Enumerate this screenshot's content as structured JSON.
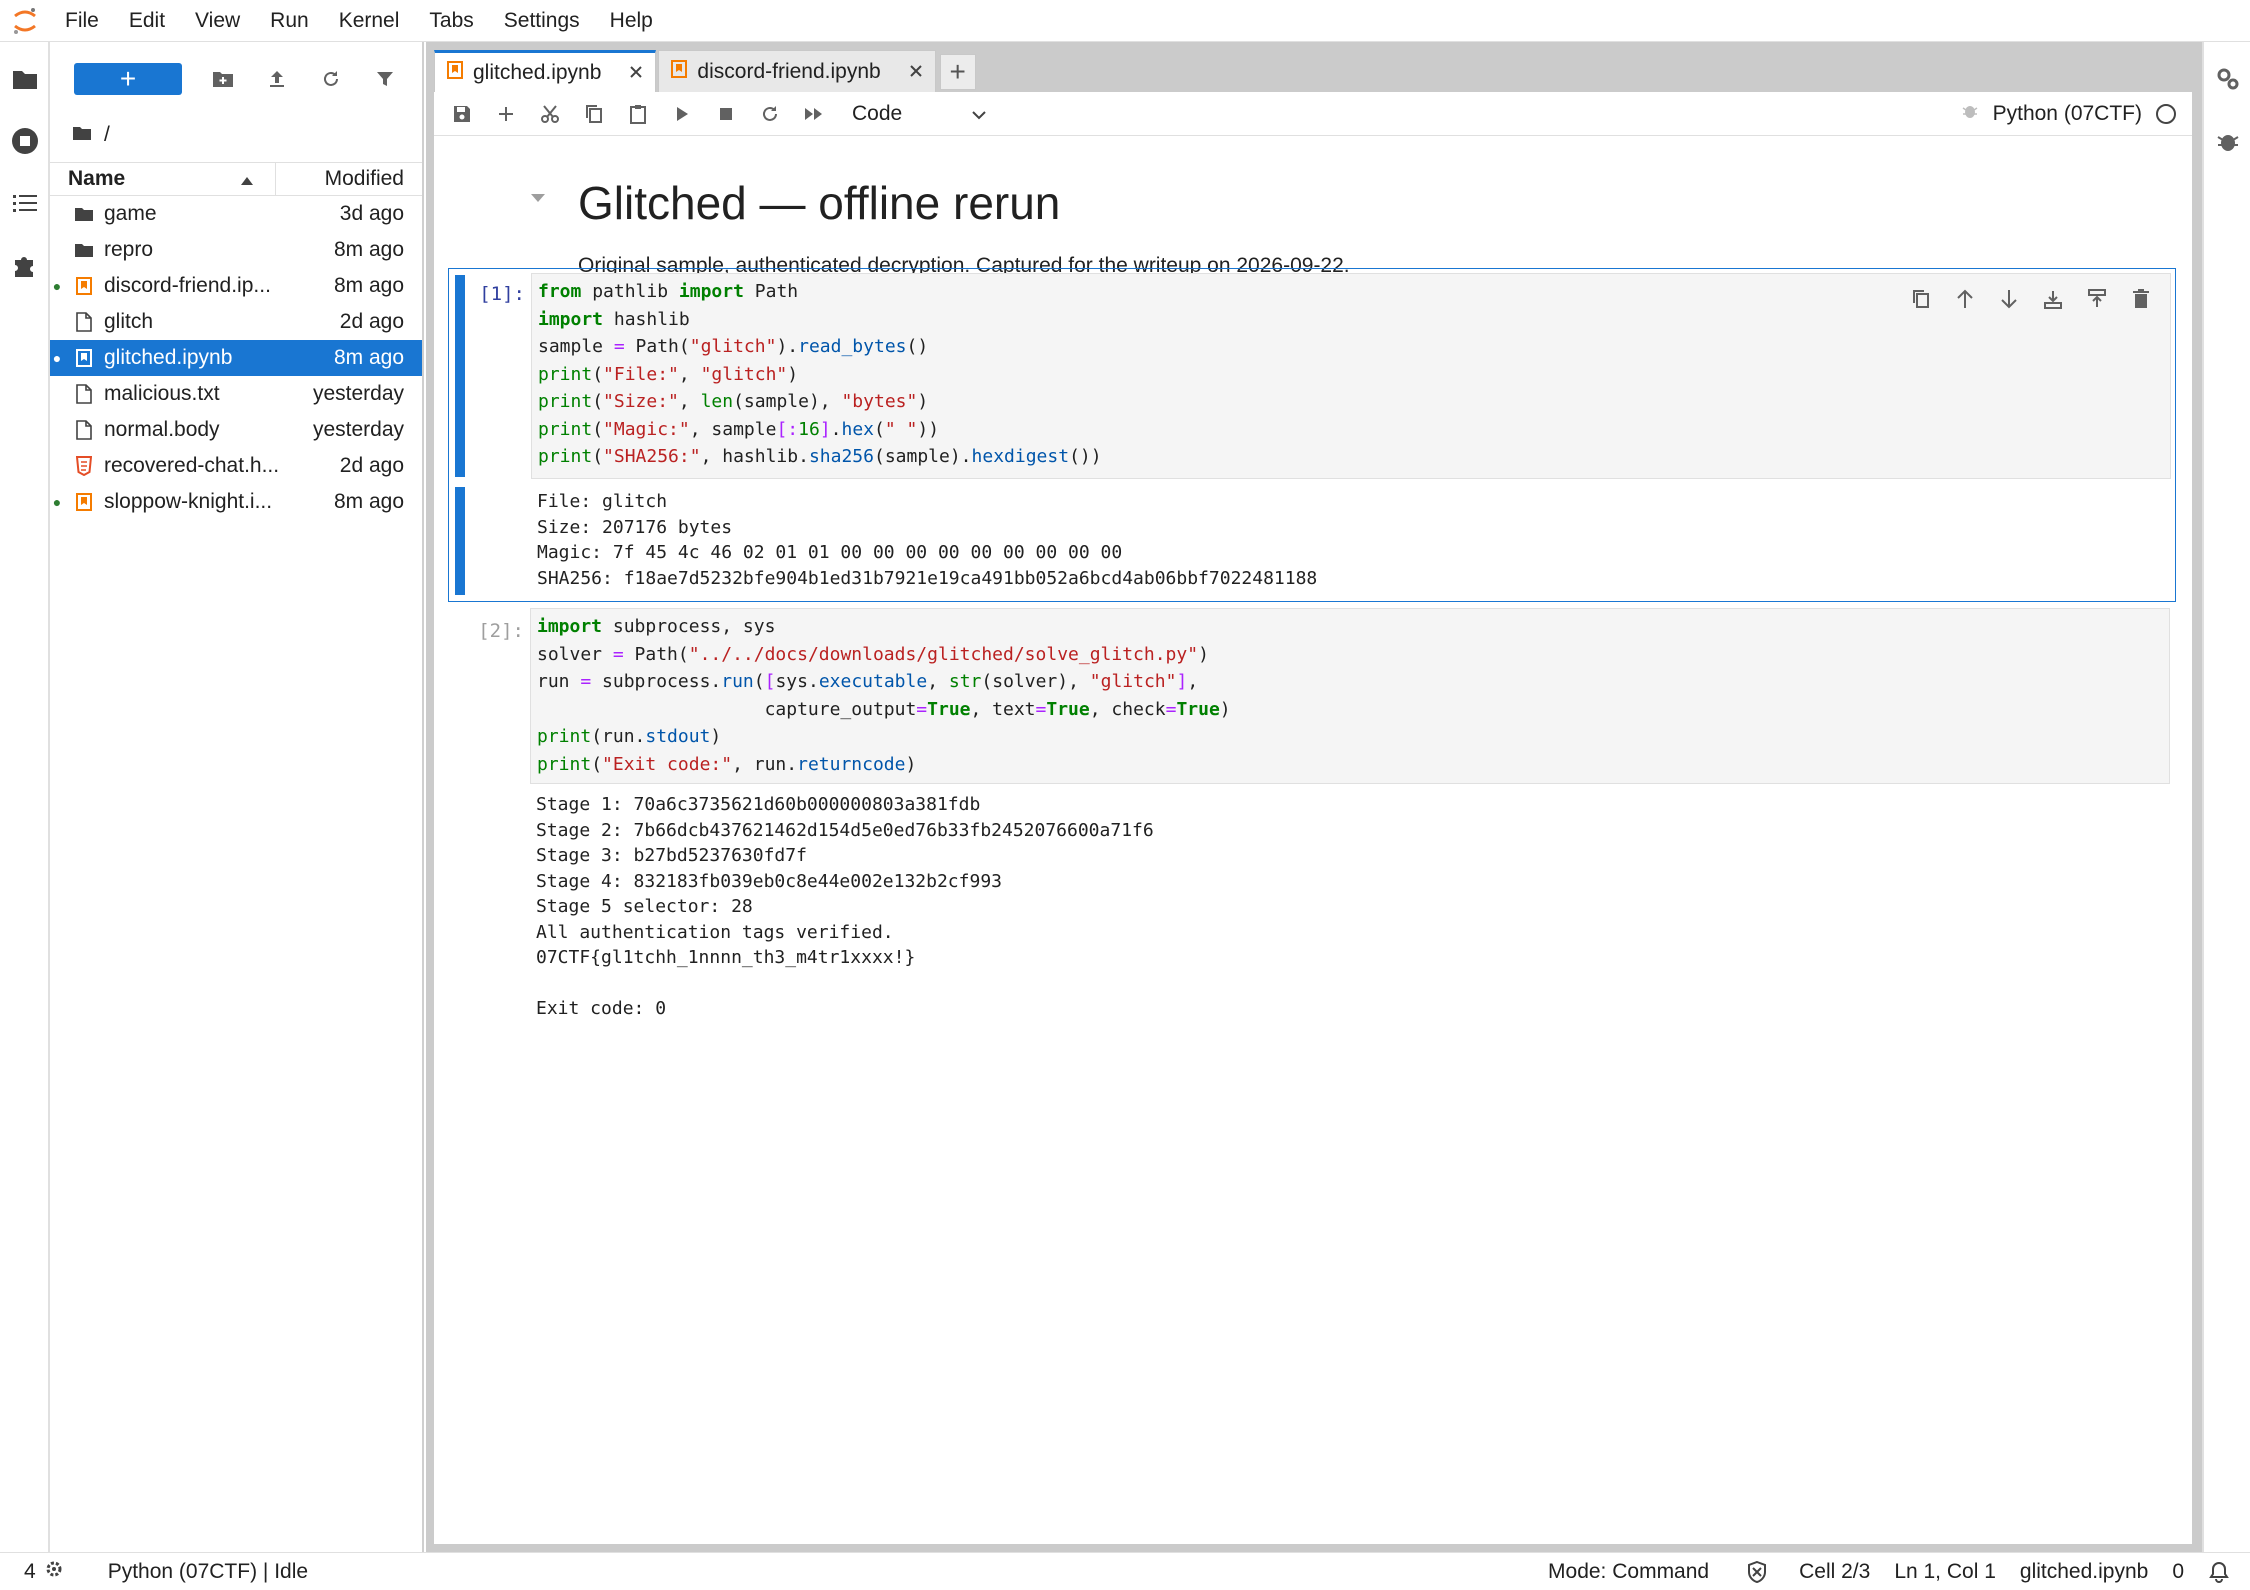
{
  "menu": [
    "File",
    "Edit",
    "View",
    "Run",
    "Kernel",
    "Tabs",
    "Settings",
    "Help"
  ],
  "file_browser": {
    "new_label": "+",
    "breadcrumb": "/",
    "columns": {
      "name": "Name",
      "modified": "Modified"
    },
    "files": [
      {
        "name": "game",
        "modified": "3d ago",
        "icon": "folder-icon",
        "running": false,
        "selected": false
      },
      {
        "name": "repro",
        "modified": "8m ago",
        "icon": "folder-icon",
        "running": false,
        "selected": false
      },
      {
        "name": "discord-friend.ip...",
        "modified": "8m ago",
        "icon": "notebook-icon",
        "running": true,
        "selected": false
      },
      {
        "name": "glitch",
        "modified": "2d ago",
        "icon": "file-icon",
        "running": false,
        "selected": false
      },
      {
        "name": "glitched.ipynb",
        "modified": "8m ago",
        "icon": "notebook-icon",
        "running": true,
        "selected": true
      },
      {
        "name": "malicious.txt",
        "modified": "yesterday",
        "icon": "file-icon",
        "running": false,
        "selected": false
      },
      {
        "name": "normal.body",
        "modified": "yesterday",
        "icon": "file-icon",
        "running": false,
        "selected": false
      },
      {
        "name": "recovered-chat.h...",
        "modified": "2d ago",
        "icon": "html-file-icon",
        "running": false,
        "selected": false
      },
      {
        "name": "sloppow-knight.i...",
        "modified": "8m ago",
        "icon": "notebook-icon",
        "running": true,
        "selected": false
      }
    ]
  },
  "tabs": [
    {
      "label": "glitched.ipynb",
      "active": true
    },
    {
      "label": "discord-friend.ipynb",
      "active": false
    }
  ],
  "tab_add_label": "+",
  "toolbar": {
    "cell_type": "Code",
    "kernel_name": "Python (07CTF)"
  },
  "notebook": {
    "title": "Glitched — offline rerun",
    "subtitle": "Original sample, authenticated decryption. Captured for the writeup on 2026-09-22.",
    "cells": [
      {
        "prompt": "[1]:",
        "code": [
          "from pathlib import Path",
          "import hashlib",
          "sample = Path(\"glitch\").read_bytes()",
          "print(\"File:\", \"glitch\")",
          "print(\"Size:\", len(sample), \"bytes\")",
          "print(\"Magic:\", sample[:16].hex(\" \"))",
          "print(\"SHA256:\", hashlib.sha256(sample).hexdigest())"
        ],
        "output": [
          "File: glitch",
          "Size: 207176 bytes",
          "Magic: 7f 45 4c 46 02 01 01 00 00 00 00 00 00 00 00 00",
          "SHA256: f18ae7d5232bfe904b1ed31b7921e19ca491bb052a6bcd4ab06bbf7022481188"
        ]
      },
      {
        "prompt": "[2]:",
        "code": [
          "import subprocess, sys",
          "solver = Path(\"../../docs/downloads/glitched/solve_glitch.py\")",
          "run = subprocess.run([sys.executable, str(solver), \"glitch\"],",
          "                     capture_output=True, text=True, check=True)",
          "print(run.stdout)",
          "print(\"Exit code:\", run.returncode)"
        ],
        "output": [
          "Stage 1: 70a6c3735621d60b000000803a381fdb",
          "Stage 2: 7b66dcb437621462d154d5e0ed76b33fb2452076600a71f6",
          "Stage 3: b27bd5237630fd7f",
          "Stage 4: 832183fb039eb0c8e44e002e132b2cf993",
          "Stage 5 selector: 28",
          "All authentication tags verified.",
          "07CTF{gl1tchh_1nnnn_th3_m4tr1xxxx!}",
          "",
          "Exit code: 0"
        ]
      }
    ]
  },
  "status": {
    "terminals": "4",
    "kernel": "Python (07CTF) | Idle",
    "mode": "Mode: Command",
    "cell": "Cell 2/3",
    "position": "Ln 1, Col 1",
    "file": "glitched.ipynb",
    "notifications": "0"
  },
  "colors": {
    "accent": "#1976d2",
    "running_dot": "#2e7d32",
    "notebook_icon": "#f57c00"
  }
}
